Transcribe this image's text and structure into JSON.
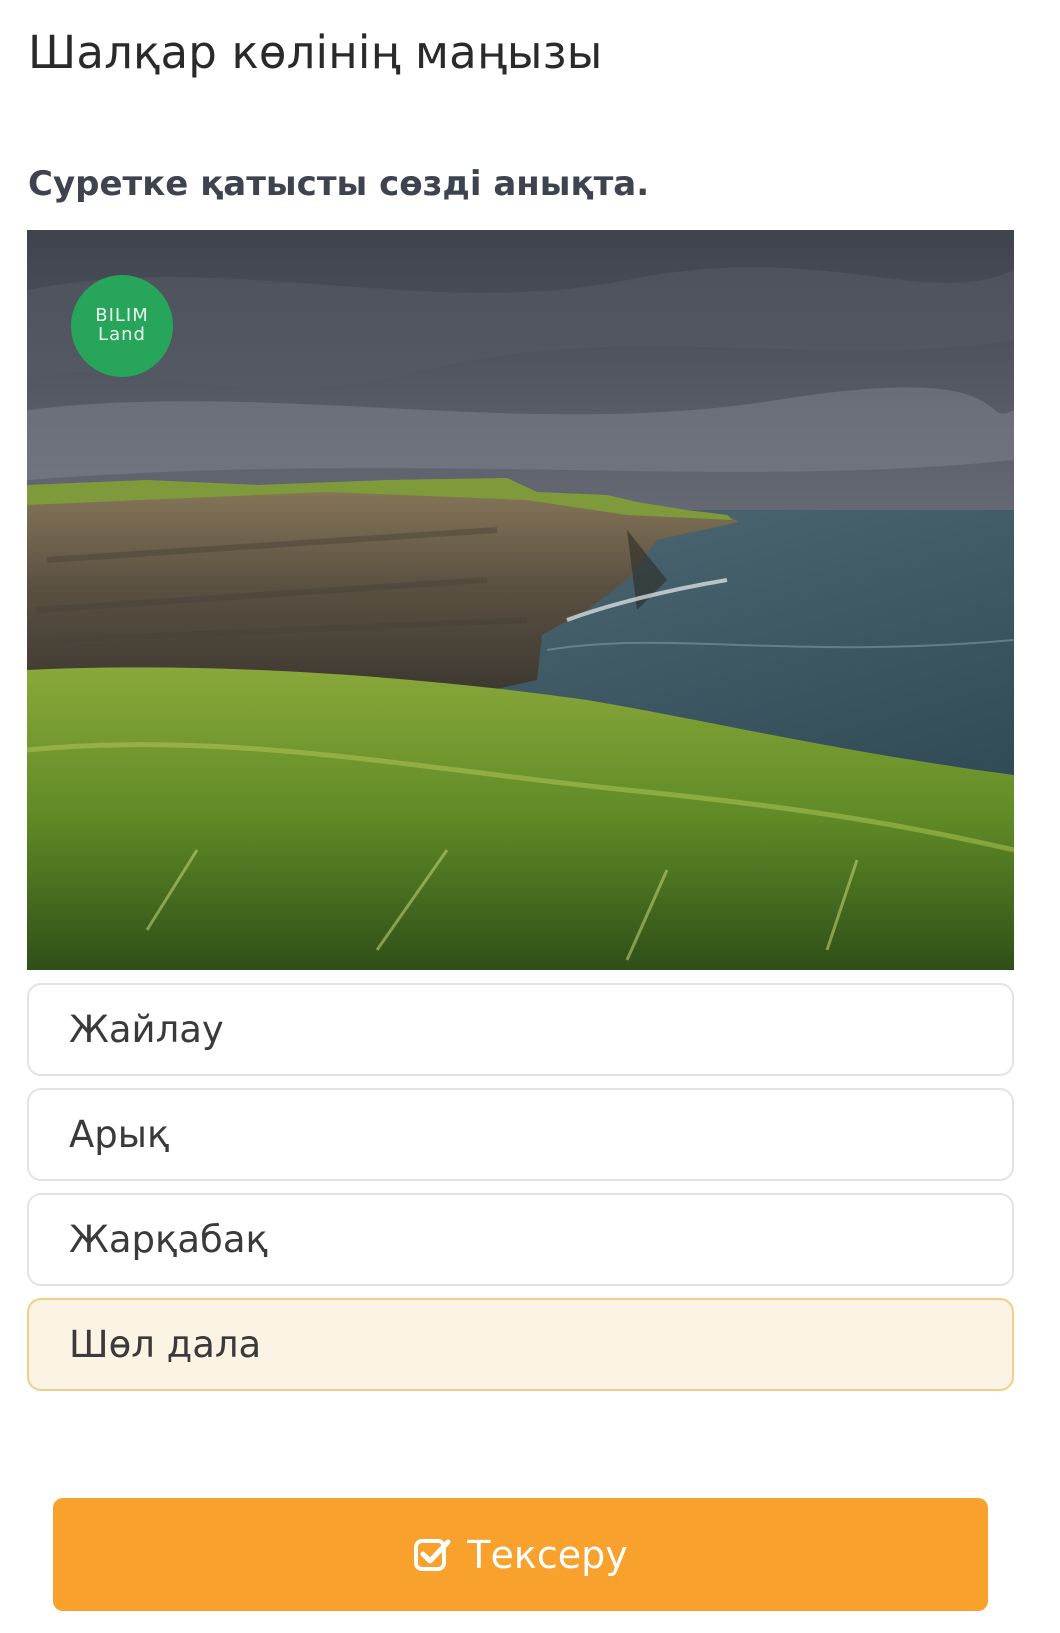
{
  "header": {
    "title": "Шалқар көлінің маңызы"
  },
  "question": {
    "text": "Суретке қатысты сөзді анықта."
  },
  "image": {
    "logo_line1": "BILIM",
    "logo_line2": "Land",
    "logo_color": "#27a55a"
  },
  "options": [
    {
      "label": "Жайлау",
      "selected": false
    },
    {
      "label": "Арық",
      "selected": false
    },
    {
      "label": "Жарқабақ",
      "selected": false
    },
    {
      "label": "Шөл дала",
      "selected": true
    }
  ],
  "submit": {
    "label": "Тексеру",
    "icon": "check-square-icon",
    "color": "#f8a12d"
  },
  "colors": {
    "selected_bg": "#fbf3e3",
    "selected_border": "#f2cf86"
  }
}
